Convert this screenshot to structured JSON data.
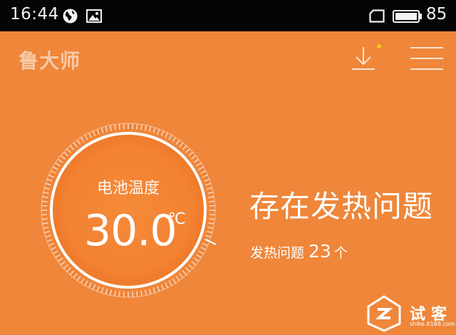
{
  "status_bar": {
    "time": "16:44",
    "battery_level": "85",
    "icons": [
      "globe-icon",
      "image-icon",
      "phone-outline-icon",
      "battery-icon"
    ]
  },
  "header": {
    "logo": "鲁大师",
    "download_icon": "download-icon",
    "menu_icon": "hamburger-menu-icon",
    "notification_dot_color": "#ffc61a"
  },
  "gauge": {
    "label": "电池温度",
    "value": "30.0",
    "unit": "℃"
  },
  "status": {
    "title": "存在发热问题",
    "issue_label": "发热问题",
    "issue_count": "23",
    "issue_unit": "个"
  },
  "watermark": {
    "name": "试客",
    "url": "shike.it168.com"
  },
  "colors": {
    "background": "#ef863a",
    "status_bar": "#050505",
    "logo_text": "#f7c9a6",
    "text": "#ffffff"
  }
}
